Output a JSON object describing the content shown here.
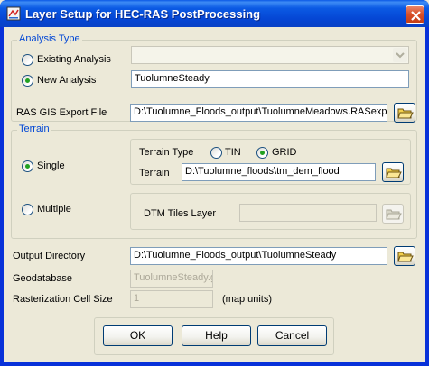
{
  "window": {
    "title": "Layer Setup for HEC-RAS PostProcessing",
    "title_icon": "layers-app-icon",
    "close_icon": "close-icon"
  },
  "analysis_type": {
    "legend": "Analysis Type",
    "existing_label": "Existing Analysis",
    "existing_selected": false,
    "existing_combo_value": "",
    "new_label": "New Analysis",
    "new_selected": true,
    "new_value": "TuolumneSteady"
  },
  "ras_export": {
    "label": "RAS GIS Export File",
    "value": "D:\\Tuolumne_Floods_output\\TuolumneMeadows.RASexport"
  },
  "terrain": {
    "legend": "Terrain",
    "single_label": "Single",
    "single_selected": true,
    "type_label": "Terrain Type",
    "tin_label": "TIN",
    "tin_selected": false,
    "grid_label": "GRID",
    "grid_selected": true,
    "terrain_label": "Terrain",
    "terrain_value": "D:\\Tuolumne_floods\\tm_dem_flood",
    "multiple_label": "Multiple",
    "multiple_selected": false,
    "dtm_label": "DTM Tiles Layer",
    "dtm_value": ""
  },
  "output": {
    "dir_label": "Output Directory",
    "dir_value": "D:\\Tuolumne_Floods_output\\TuolumneSteady",
    "gdb_label": "Geodatabase",
    "gdb_value": "TuolumneSteady.gdb",
    "cell_label": "Rasterization Cell Size",
    "cell_value": "1",
    "cell_units": "(map units)"
  },
  "buttons": {
    "ok": "OK",
    "help": "Help",
    "cancel": "Cancel"
  },
  "colors": {
    "title_bar": "#0a58e6",
    "accent": "#0046d5",
    "radio_dot": "#21a121",
    "close": "#d8502a"
  }
}
